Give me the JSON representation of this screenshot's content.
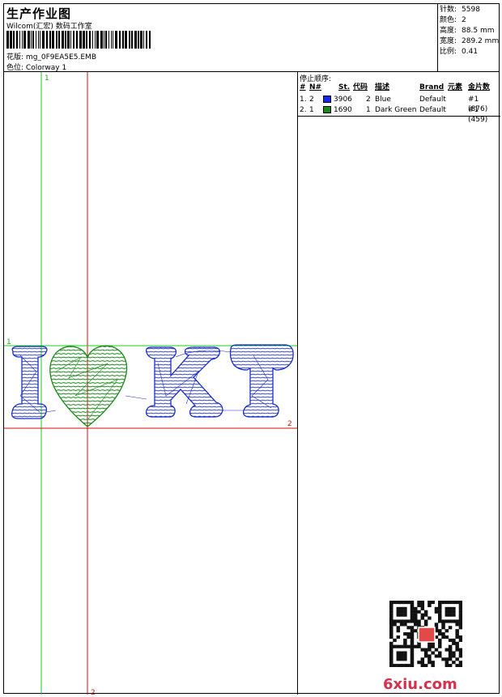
{
  "header": {
    "title": "生产作业图",
    "company": "Wilcom(汇宏) 数码工作室",
    "design_label": "花版:",
    "design_value": "mg_0F9EA5E5.EMB",
    "colorway_label": "色位:",
    "colorway_value": "Colorway 1"
  },
  "stats": [
    {
      "label": "针数:",
      "value": "5598"
    },
    {
      "label": "颜色:",
      "value": "2"
    },
    {
      "label": "高度:",
      "value": "88.5 mm"
    },
    {
      "label": "宽度:",
      "value": "289.2 mm"
    },
    {
      "label": "比例:",
      "value": "0.41"
    }
  ],
  "stop_sequence": {
    "title": "停止顺序:",
    "headers": [
      "#",
      "N#",
      "St.",
      "代码",
      "描述",
      "Brand",
      "元素",
      "金片数"
    ],
    "rows": [
      {
        "num": "1.",
        "n": "2",
        "color": "#1428e6",
        "st": "3906",
        "code": "2",
        "desc": "Blue",
        "brand": "Default",
        "elem": "#1 (876)"
      },
      {
        "num": "2.",
        "n": "1",
        "color": "#1a8a1a",
        "st": "1690",
        "code": "1",
        "desc": "Dark Green",
        "brand": "Default",
        "elem": "#1 (459)"
      }
    ]
  },
  "design": {
    "text_letters": [
      "I",
      "K",
      "T"
    ],
    "guides": {
      "v1": "1",
      "h1": "1",
      "h2": "2",
      "v2": "2"
    },
    "colors": {
      "blue": "#1a2ec8",
      "green": "#1a8a1a",
      "guide_green": "#22cc22",
      "guide_red": "#cc1111"
    }
  },
  "watermark": "6xiu.com"
}
